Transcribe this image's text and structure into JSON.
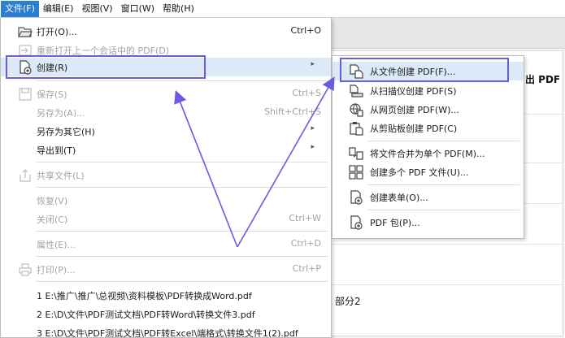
{
  "menubar": {
    "items": [
      "文件(F)",
      "编辑(E)",
      "视图(V)",
      "窗口(W)",
      "帮助(H)"
    ]
  },
  "background": {
    "right_title": "出 PDF",
    "right_fragment": "部分2"
  },
  "file_menu": {
    "open": {
      "label": "打开(O)...",
      "shortcut": "Ctrl+O"
    },
    "reopen": {
      "label": "重新打开上一个会话中的 PDF(D)"
    },
    "create": {
      "label": "创建(R)",
      "arrow": "▸"
    },
    "save": {
      "label": "保存(S)",
      "shortcut": "Ctrl+S"
    },
    "save_as": {
      "label": "另存为(A)...",
      "shortcut": "Shift+Ctrl+S"
    },
    "save_as_other": {
      "label": "另存为其它(H)",
      "arrow": "▸"
    },
    "export_to": {
      "label": "导出到(T)",
      "arrow": "▸"
    },
    "share": {
      "label": "共享文件(L)"
    },
    "revert": {
      "label": "恢复(V)"
    },
    "close": {
      "label": "关闭(C)",
      "shortcut": "Ctrl+W"
    },
    "properties": {
      "label": "属性(E)...",
      "shortcut": "Ctrl+D"
    },
    "print": {
      "label": "打印(P)...",
      "shortcut": "Ctrl+P"
    },
    "recent_files": [
      "1 E:\\推广\\推广\\总视频\\资料模板\\PDF转换成Word.pdf",
      "2 E:\\D\\文件\\PDF测试文档\\PDF转Word\\转换文件3.pdf",
      "3 E:\\D\\文件\\PDF测试文档\\PDF转Excel\\端格式\\转换文件1(2).pdf"
    ]
  },
  "create_submenu": {
    "from_file": "从文件创建 PDF(F)...",
    "from_scanner": "从扫描仪创建 PDF(S)",
    "from_web": "从网页创建 PDF(W)...",
    "from_clipboard": "从剪贴板创建 PDF(C)",
    "combine": "将文件合并为单个 PDF(M)...",
    "create_multiple": "创建多个 PDF 文件(U)...",
    "create_form": "创建表单(O)...",
    "pdf_package": "PDF 包(P)..."
  },
  "colors": {
    "highlight_box": "#6c5be0",
    "menu_hover": "#dbe9f9",
    "menubar_active": "#2b7fd1"
  }
}
